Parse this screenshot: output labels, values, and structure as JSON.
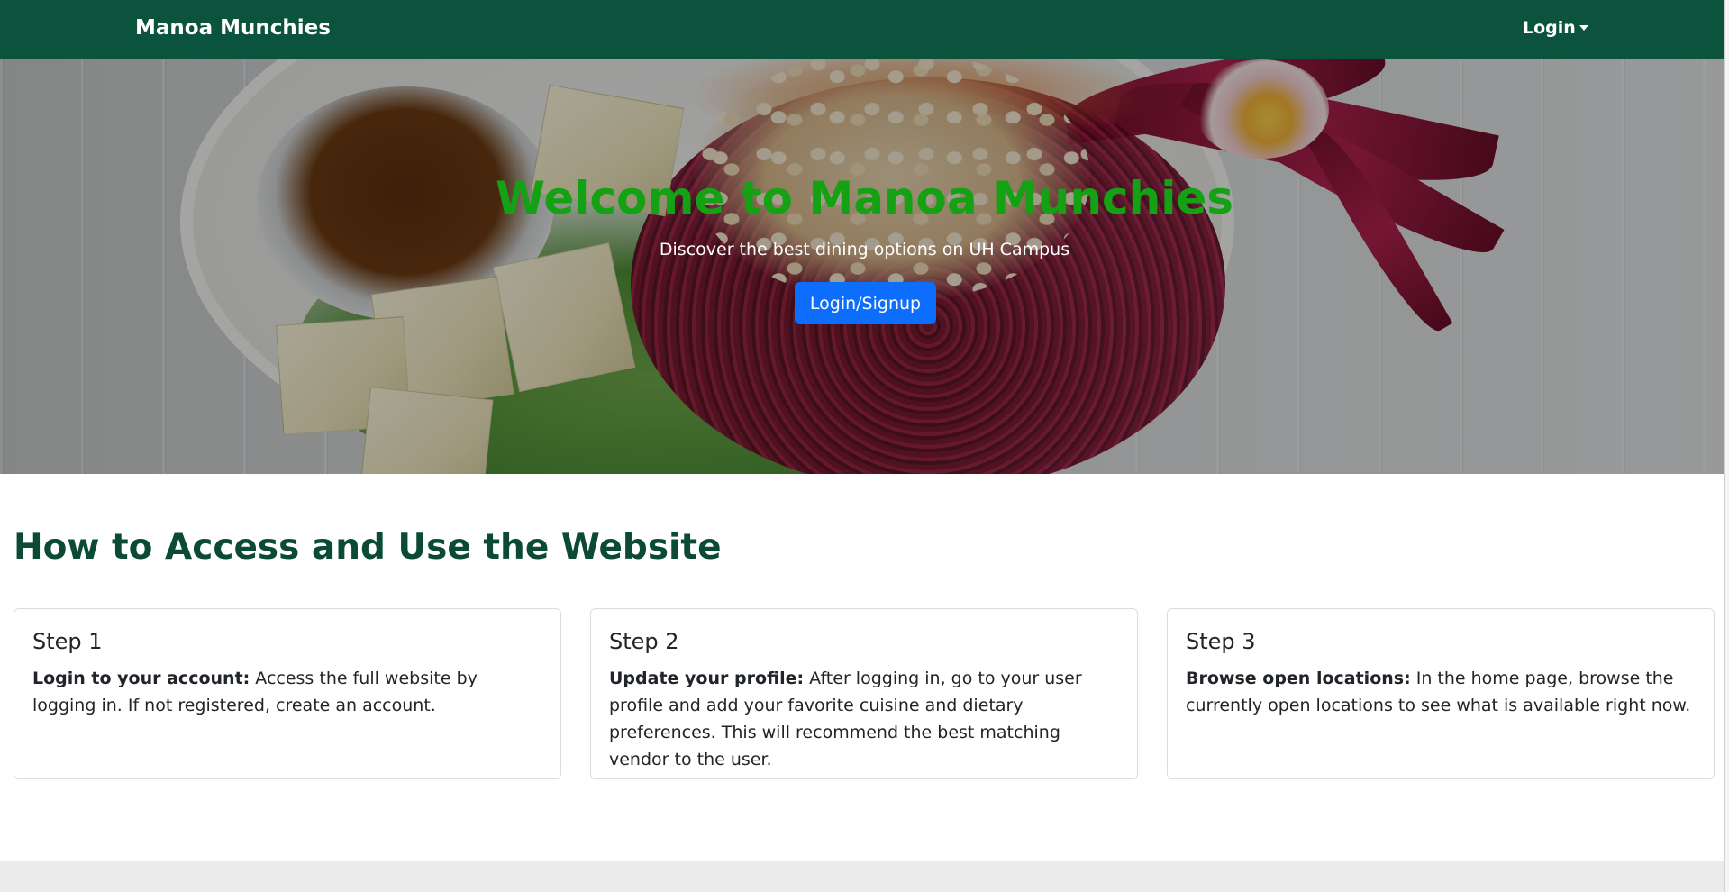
{
  "navbar": {
    "brand": "Manoa Munchies",
    "login_label": "Login"
  },
  "hero": {
    "title": "Welcome to Manoa Munchies",
    "subtitle": "Discover the best dining options on UH Campus",
    "button_label": "Login/Signup"
  },
  "section": {
    "title": "How to Access and Use the Website"
  },
  "steps": [
    {
      "title": "Step 1",
      "bold": "Login to your account:",
      "text": " Access the full website by logging in. If not registered, create an account."
    },
    {
      "title": "Step 2",
      "bold": "Update your profile:",
      "text": " After logging in, go to your user profile and add your favorite cuisine and dietary preferences. This will recommend the best matching vendor to the user."
    },
    {
      "title": "Step 3",
      "bold": "Browse open locations:",
      "text": " In the home page, browse the currently open locations to see what is available right now."
    }
  ],
  "colors": {
    "navbar_bg": "#0b533d",
    "hero_title": "#14a214",
    "primary_button": "#0d6efd",
    "section_title": "#0b4a35"
  }
}
